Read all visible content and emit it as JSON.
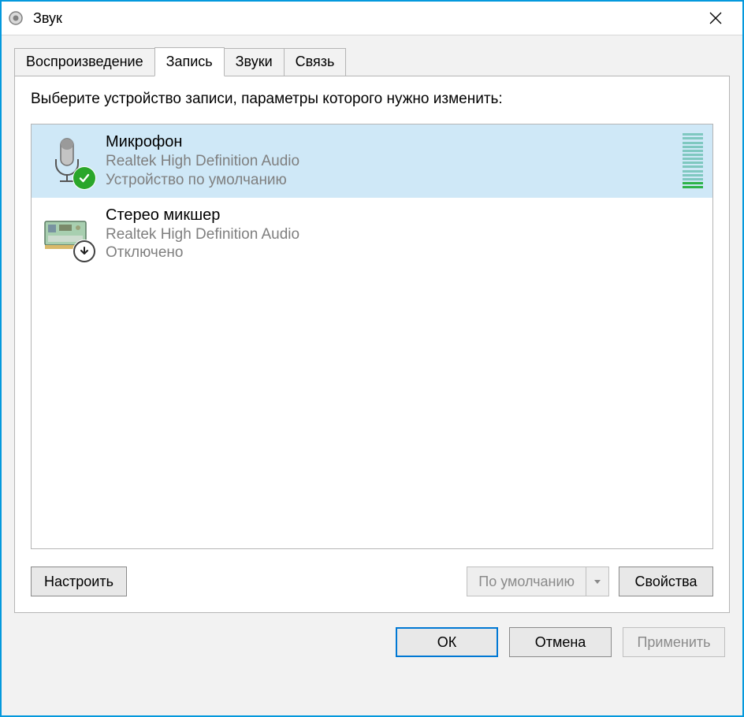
{
  "titlebar": {
    "title": "Звук"
  },
  "tabs": {
    "playback": "Воспроизведение",
    "recording": "Запись",
    "sounds": "Звуки",
    "communications": "Связь"
  },
  "instruction": "Выберите устройство записи, параметры которого нужно изменить:",
  "devices": [
    {
      "name": "Микрофон",
      "driver": "Realtek High Definition Audio",
      "status": "Устройство по умолчанию",
      "selected": true,
      "badge": "default",
      "meter": true
    },
    {
      "name": "Стерео микшер",
      "driver": "Realtek High Definition Audio",
      "status": "Отключено",
      "selected": false,
      "badge": "disabled",
      "meter": false
    }
  ],
  "panelButtons": {
    "configure": "Настроить",
    "setDefault": "По умолчанию",
    "properties": "Свойства"
  },
  "bottomButtons": {
    "ok": "ОК",
    "cancel": "Отмена",
    "apply": "Применить"
  }
}
